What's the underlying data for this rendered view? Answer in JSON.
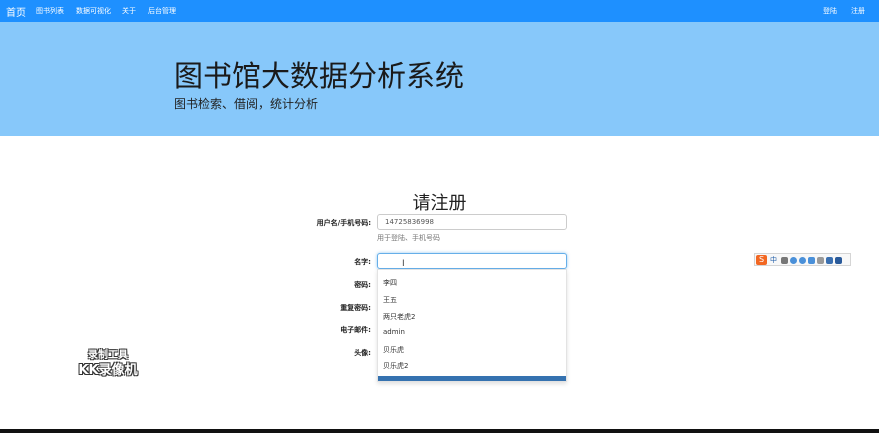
{
  "navbar": {
    "brand": "首页",
    "left_links": [
      "图书列表",
      "数据可视化",
      "关于",
      "后台管理"
    ],
    "right_links": [
      "登陆",
      "注册"
    ]
  },
  "jumbotron": {
    "title": "图书馆大数据分析系统",
    "subtitle": "图书检索、借阅，统计分析"
  },
  "form": {
    "title": "请注册",
    "username": {
      "label": "用户名/手机号码:",
      "value": "14725836998",
      "help": "用于登陆、手机号码"
    },
    "name": {
      "label": "名字:",
      "value": ""
    },
    "password": {
      "label": "密码:"
    },
    "password_repeat": {
      "label": "重复密码:"
    },
    "email": {
      "label": "电子邮件:"
    },
    "avatar": {
      "label": "头像:"
    }
  },
  "autocomplete": {
    "items": [
      "李四",
      "王五",
      "两只老虎2",
      "admin",
      "贝乐虎",
      "贝乐虎2"
    ]
  },
  "ime_toolbar": {
    "logo": "S",
    "mode": "中"
  },
  "watermark": {
    "line1": "录制工具",
    "line2": "KK录像机"
  },
  "colors": {
    "navbar": "#1e90ff",
    "jumbotron": "#87c8fa",
    "dropdown_accent": "#3572b0"
  }
}
